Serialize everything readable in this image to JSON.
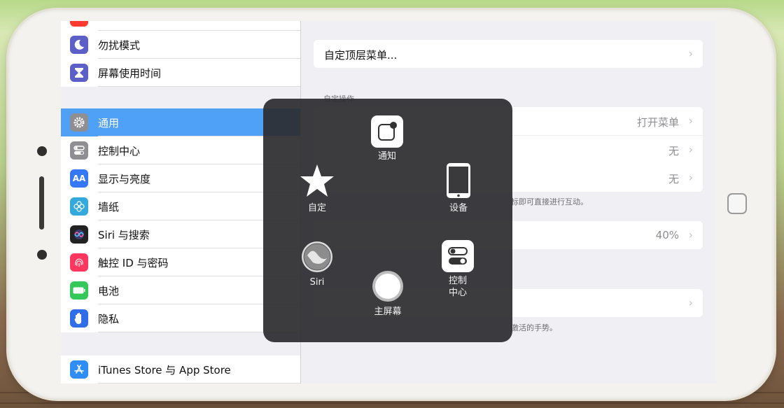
{
  "sidebar": {
    "items": [
      {
        "label": "勿扰模式",
        "icon": "moon-icon",
        "color": "#5b5fc7"
      },
      {
        "label": "屏幕使用时间",
        "icon": "hourglass-icon",
        "color": "#5b5fc7"
      },
      {
        "label": "通用",
        "icon": "gear-icon",
        "color": "#8e8e93",
        "selected": true
      },
      {
        "label": "控制中心",
        "icon": "toggles-icon",
        "color": "#8e8e93"
      },
      {
        "label": "显示与亮度",
        "icon": "text-size-icon",
        "color": "#3478f6"
      },
      {
        "label": "墙纸",
        "icon": "flower-icon",
        "color": "#34aadc"
      },
      {
        "label": "Siri 与搜索",
        "icon": "siri-icon",
        "color": "#222222"
      },
      {
        "label": "触控 ID 与密码",
        "icon": "fingerprint-icon",
        "color": "#ff375f"
      },
      {
        "label": "电池",
        "icon": "battery-icon",
        "color": "#34c759"
      },
      {
        "label": "隐私",
        "icon": "hand-icon",
        "color": "#2f6ee8"
      },
      {
        "label": "iTunes Store 与 App Store",
        "icon": "app-store-icon",
        "color": "#2f8ef5"
      }
    ]
  },
  "detail": {
    "custom_top_menu": "自定顶层菜单...",
    "section_custom_actions": "自定操作",
    "rows": [
      {
        "value": "打开菜单"
      },
      {
        "value": "无"
      },
      {
        "value": "无"
      }
    ],
    "footer_interact": "标即可直接进行互动。",
    "opacity_value": "40%",
    "footer_gesture": "激活的手势。"
  },
  "assistive_menu": {
    "notification": "通知",
    "custom": "自定",
    "device": "设备",
    "siri": "Siri",
    "home": "主屏幕",
    "control_center": "控制\n中心"
  }
}
